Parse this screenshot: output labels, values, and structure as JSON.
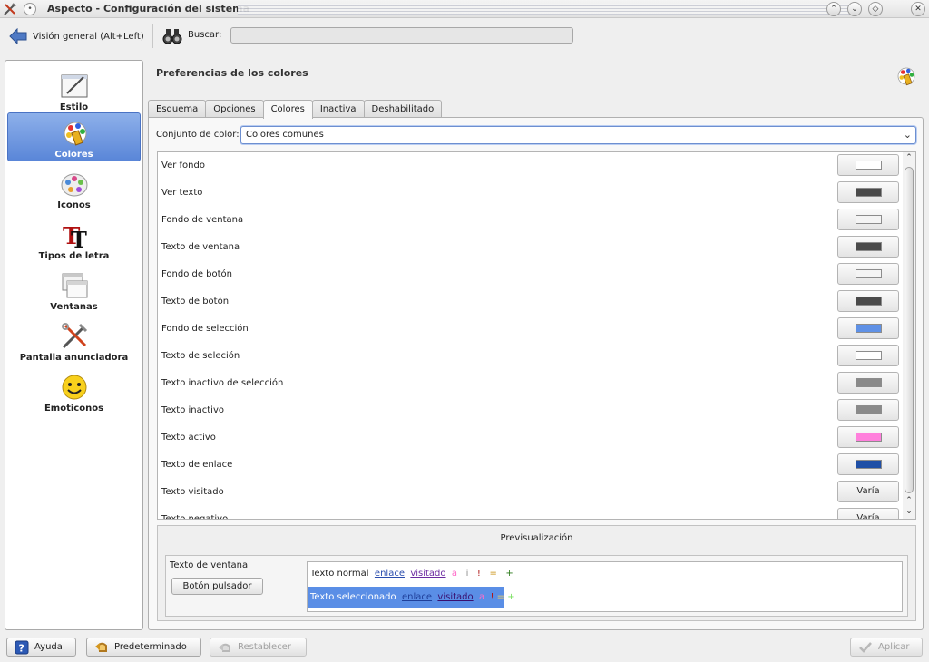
{
  "window": {
    "title": "Aspecto - Configuración del sistema",
    "menu_glyph": "•",
    "buttons": [
      "⌃",
      "⌄",
      "◇",
      "✕"
    ]
  },
  "toolbar": {
    "back_label": "Visión general (Alt+Left)",
    "search_label": "Buscar:",
    "search_value": ""
  },
  "sidebar": {
    "items": [
      {
        "label": "Estilo",
        "icon": "style-icon",
        "selected": false
      },
      {
        "label": "Colores",
        "icon": "colors-icon",
        "selected": true
      },
      {
        "label": "Iconos",
        "icon": "icons-icon",
        "selected": false
      },
      {
        "label": "Tipos de letra",
        "icon": "fonts-icon",
        "selected": false
      },
      {
        "label": "Ventanas",
        "icon": "windows-icon",
        "selected": false
      },
      {
        "label": "Pantalla anunciadora",
        "icon": "splash-screen-icon",
        "selected": false
      },
      {
        "label": "Emoticonos",
        "icon": "emoticons-icon",
        "selected": false
      }
    ]
  },
  "main": {
    "title": "Preferencias de los colores",
    "tabs": [
      {
        "label": "Esquema",
        "active": false
      },
      {
        "label": "Opciones",
        "active": false
      },
      {
        "label": "Colores",
        "active": true
      },
      {
        "label": "Inactiva",
        "active": false
      },
      {
        "label": "Deshabilitado",
        "active": false
      }
    ],
    "scheme_label": "Conjunto de color:",
    "scheme_value": "Colores comunes",
    "color_rows": [
      {
        "name": "Ver fondo",
        "color": "#ffffff"
      },
      {
        "name": "Ver texto",
        "color": "#4a4a4a"
      },
      {
        "name": "Fondo de ventana",
        "color": "#f4f4f4"
      },
      {
        "name": "Texto de ventana",
        "color": "#4a4a4a"
      },
      {
        "name": "Fondo de botón",
        "color": "#f4f4f4"
      },
      {
        "name": "Texto de botón",
        "color": "#4a4a4a"
      },
      {
        "name": "Fondo de selección",
        "color": "#5f91e6"
      },
      {
        "name": "Texto de seleción",
        "color": "#ffffff"
      },
      {
        "name": "Texto inactivo de selección",
        "color": "#8a8a8a"
      },
      {
        "name": "Texto inactivo",
        "color": "#8a8a8a"
      },
      {
        "name": "Texto activo",
        "color": "#ff80dc"
      },
      {
        "name": "Texto de enlace",
        "color": "#1f4fa6"
      },
      {
        "name": "Texto visitado",
        "value_label": "Varía"
      },
      {
        "name": "Texto negativo",
        "value_label": "Varía"
      }
    ],
    "preview": {
      "title": "Previsualización",
      "window_text": "Texto de ventana",
      "push_button": "Botón pulsador",
      "normal_text": "Texto normal",
      "selected_text": "Texto seleccionado",
      "link": "enlace",
      "visited": "visitado",
      "active": "a",
      "inactive": "i",
      "negative": "!",
      "neutral": "=",
      "positive": "+"
    }
  },
  "bottom": {
    "help": "Ayuda",
    "defaults": "Predeterminado",
    "reset": "Restablecer",
    "apply": "Aplicar"
  }
}
